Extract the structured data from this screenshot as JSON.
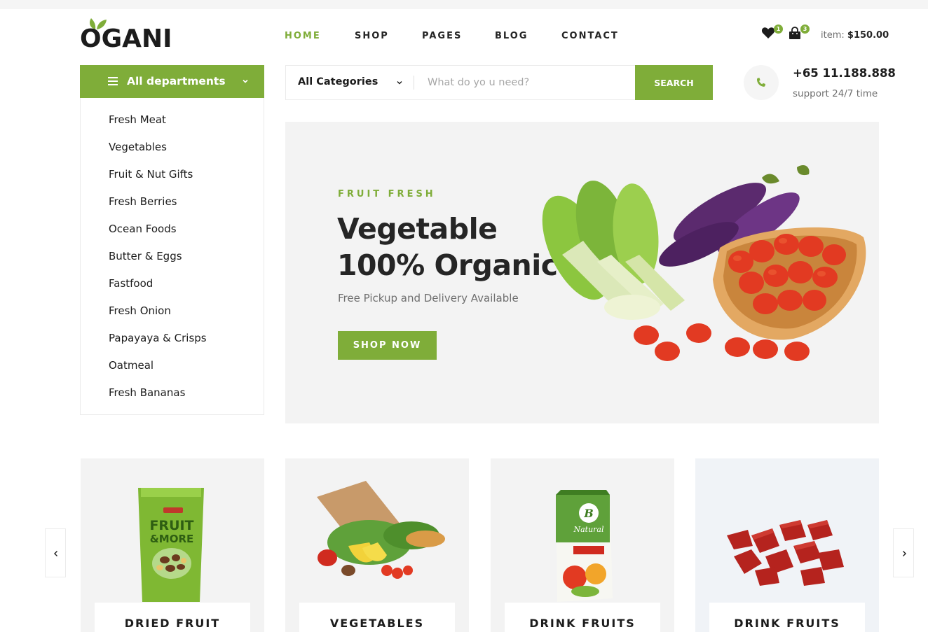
{
  "brand": {
    "logo_text": "OGANI"
  },
  "nav": {
    "items": [
      {
        "label": "HOME",
        "active": true
      },
      {
        "label": "SHOP",
        "active": false
      },
      {
        "label": "PAGES",
        "active": false
      },
      {
        "label": "BLOG",
        "active": false
      },
      {
        "label": "CONTACT",
        "active": false
      }
    ]
  },
  "header_icons": {
    "wishlist_count": "1",
    "cart_count": "3",
    "item_label": "item:",
    "item_total": "$150.00"
  },
  "departments": {
    "title": "All departments",
    "items": [
      "Fresh Meat",
      "Vegetables",
      "Fruit & Nut Gifts",
      "Fresh Berries",
      "Ocean Foods",
      "Butter & Eggs",
      "Fastfood",
      "Fresh Onion",
      "Papayaya & Crisps",
      "Oatmeal",
      "Fresh Bananas"
    ]
  },
  "search": {
    "category": "All Categories",
    "placeholder": "What do yo u need?",
    "value": "",
    "button": "SEARCH"
  },
  "contact": {
    "phone": "+65 11.188.888",
    "support": "support 24/7 time"
  },
  "hero": {
    "kicker": "FRUIT FRESH",
    "title_line1": "Vegetable",
    "title_line2": "100% Organic",
    "subtitle": "Free Pickup and Delivery Available",
    "button": "SHOP NOW"
  },
  "categories": [
    {
      "label": "DRIED FRUIT",
      "icon": "fruit-and-more-bag-image"
    },
    {
      "label": "VEGETABLES",
      "icon": "grocery-bag-image"
    },
    {
      "label": "DRINK FRUITS",
      "icon": "juice-carton-image"
    },
    {
      "label": "DRINK FRUITS",
      "icon": "meat-cubes-image"
    }
  ],
  "colors": {
    "accent": "#7fad39",
    "text": "#1c1c1c",
    "muted": "#6f6f6f",
    "panel": "#f3f3f3"
  }
}
